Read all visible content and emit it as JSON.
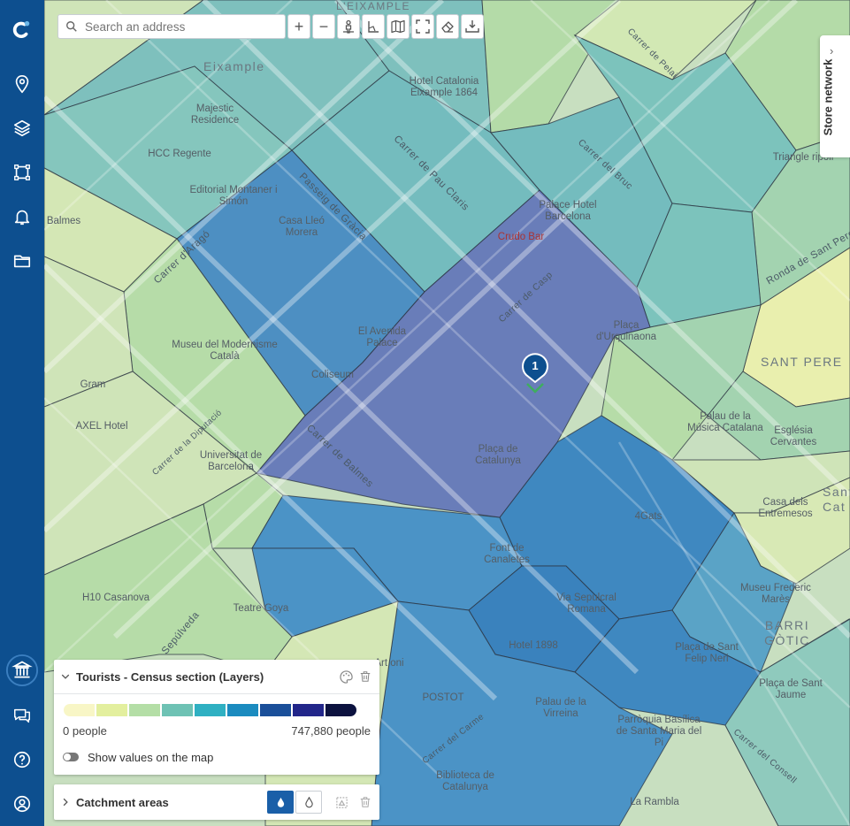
{
  "search": {
    "placeholder": "Search an address"
  },
  "toolbar": {
    "zoom_in": "+",
    "zoom_out": "−"
  },
  "store_network": {
    "label": "Store network"
  },
  "legend": {
    "title": "Tourists - Census section (Layers)",
    "min_label": "0 people",
    "max_label": "747,880 people",
    "toggle_label": "Show values on the map",
    "colors": [
      "#f8f6c6",
      "#e3ef9e",
      "#b4dea6",
      "#6ec2b4",
      "#2fb0c2",
      "#1b8bbf",
      "#1a4f99",
      "#22268a",
      "#0c123f"
    ]
  },
  "catchment": {
    "title": "Catchment areas"
  },
  "marker": {
    "number": "1"
  },
  "districts": [
    "Eixample",
    "L'EIXAMPLE",
    "SANT PERE",
    "BARRI GÒTIC",
    "Sant Cat"
  ],
  "places": [
    {
      "name": "Hotel Catalonia Eixample 1864"
    },
    {
      "name": "Majestic Residence"
    },
    {
      "name": "HCC Regente"
    },
    {
      "name": "Editorial Montaner i Simón"
    },
    {
      "name": "Casa Lleó Morera"
    },
    {
      "name": "Palace Hotel Barcelona"
    },
    {
      "name": "Crudo Bar"
    },
    {
      "name": "El Avenida Palace"
    },
    {
      "name": "Museu del Modernisme Català"
    },
    {
      "name": "Coliseum"
    },
    {
      "name": "Plaça d'Urquinaona"
    },
    {
      "name": "Plaça de Catalunya"
    },
    {
      "name": "Palau de la Música Catalana"
    },
    {
      "name": "Església Cervantes"
    },
    {
      "name": "Universitat de Barcelona"
    },
    {
      "name": "AXEL Hotel"
    },
    {
      "name": "Gram"
    },
    {
      "name": "4Gats"
    },
    {
      "name": "Casa dels Entremesos"
    },
    {
      "name": "Font de Canaletes"
    },
    {
      "name": "Via Sepulcral Romana"
    },
    {
      "name": "Museu Frederic Marès"
    },
    {
      "name": "H10 Casanova"
    },
    {
      "name": "Teatre Goya"
    },
    {
      "name": "Hotel 1898"
    },
    {
      "name": "Plaça de Sant Felip Neri"
    },
    {
      "name": "POSTOT"
    },
    {
      "name": "Palau de la Virreina"
    },
    {
      "name": "Parròquia Basílica de Santa Maria del Pi"
    },
    {
      "name": "Plaça de Sant Jaume"
    },
    {
      "name": "Biblioteca de Catalunya"
    },
    {
      "name": "La Rambla"
    },
    {
      "name": "Triangle ripoll"
    },
    {
      "name": "Balmes"
    },
    {
      "name": "Art oni"
    }
  ],
  "streets": [
    "Carrer de Pau Claris",
    "Carrer del Bruc",
    "Passeig de Gràcia",
    "Carrer d'Aragó",
    "Carrer de Casp",
    "Carrer de Balmes",
    "Ronda de Sant Pere",
    "Carrer de la Diputació",
    "Sepúlveda",
    "Carrer del Carme",
    "Carrer de Pelai",
    "Carrer del Consell"
  ]
}
